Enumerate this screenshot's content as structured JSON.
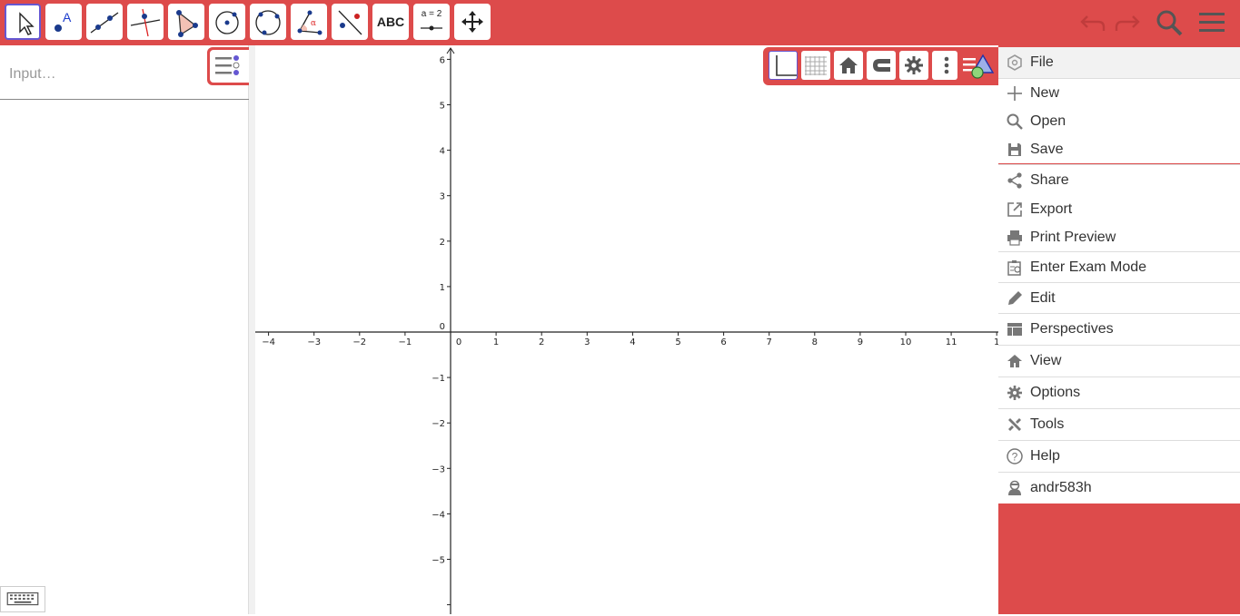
{
  "toolbar": {
    "tools": [
      {
        "name": "move-tool"
      },
      {
        "name": "point-tool"
      },
      {
        "name": "line-tool"
      },
      {
        "name": "perpendicular-line-tool"
      },
      {
        "name": "polygon-tool"
      },
      {
        "name": "circle-center-point-tool"
      },
      {
        "name": "circle-three-points-tool"
      },
      {
        "name": "angle-tool"
      },
      {
        "name": "reflect-about-line-tool"
      },
      {
        "name": "text-tool",
        "label": "ABC"
      },
      {
        "name": "slider-tool",
        "label": "a = 2"
      },
      {
        "name": "move-graphics-view-tool"
      }
    ],
    "accent_color": "#dd4b4b",
    "selected_color": "#6557d2"
  },
  "algebra": {
    "input_placeholder": "Input…"
  },
  "graphics": {
    "x_ticks": [
      "−4",
      "−3",
      "−2",
      "−1",
      "0",
      "1",
      "2",
      "3",
      "4",
      "5",
      "6",
      "7",
      "8",
      "9",
      "10",
      "11",
      "1"
    ],
    "y_ticks": [
      "6",
      "5",
      "4",
      "3",
      "2",
      "1",
      "0",
      "−1",
      "−2",
      "−3",
      "−4",
      "−5"
    ]
  },
  "menu": {
    "items": [
      {
        "label": "File",
        "icon": "file-icon"
      },
      {
        "label": "New",
        "icon": "plus-icon"
      },
      {
        "label": "Open",
        "icon": "search-icon"
      },
      {
        "label": "Save",
        "icon": "save-icon"
      },
      {
        "label": "Share",
        "icon": "share-icon"
      },
      {
        "label": "Export",
        "icon": "export-icon"
      },
      {
        "label": "Print Preview",
        "icon": "print-icon"
      },
      {
        "label": "Enter Exam Mode",
        "icon": "exam-icon"
      },
      {
        "label": "Edit",
        "icon": "pencil-icon"
      },
      {
        "label": "Perspectives",
        "icon": "perspectives-icon"
      },
      {
        "label": "View",
        "icon": "home-icon"
      },
      {
        "label": "Options",
        "icon": "gear-icon"
      },
      {
        "label": "Tools",
        "icon": "tools-icon"
      },
      {
        "label": "Help",
        "icon": "help-icon"
      },
      {
        "label": "andr583h",
        "icon": "user-icon"
      }
    ]
  }
}
